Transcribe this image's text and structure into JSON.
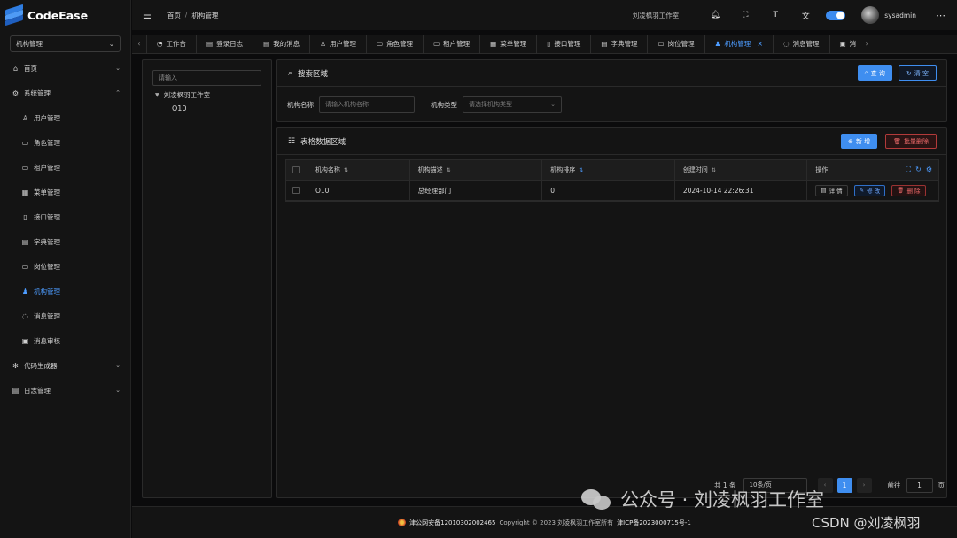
{
  "app": {
    "name": "CodeEase"
  },
  "sidebar": {
    "org_select": "机构管理",
    "items": [
      {
        "label": "首页",
        "icon": "home-icon",
        "expandable": true
      },
      {
        "label": "系统管理",
        "icon": "gear-icon",
        "expandable": true,
        "expanded": true
      },
      {
        "label": "用户管理",
        "icon": "user-icon"
      },
      {
        "label": "角色管理",
        "icon": "role-icon"
      },
      {
        "label": "租户管理",
        "icon": "tenant-icon"
      },
      {
        "label": "菜单管理",
        "icon": "grid-icon"
      },
      {
        "label": "接口管理",
        "icon": "api-icon"
      },
      {
        "label": "字典管理",
        "icon": "dictionary-icon"
      },
      {
        "label": "岗位管理",
        "icon": "position-icon"
      },
      {
        "label": "机构管理",
        "icon": "user-icon",
        "active": true
      },
      {
        "label": "消息管理",
        "icon": "message-icon"
      },
      {
        "label": "消息审核",
        "icon": "audit-icon"
      },
      {
        "label": "代码生成器",
        "icon": "gear-icon",
        "expandable": true
      },
      {
        "label": "日志管理",
        "icon": "log-icon",
        "expandable": true
      }
    ]
  },
  "header": {
    "breadcrumb": [
      "首页",
      "机构管理"
    ],
    "studio": "刘凌枫羽工作室",
    "username": "sysadmin"
  },
  "tabs": [
    {
      "label": "工作台",
      "icon": "dashboard-icon"
    },
    {
      "label": "登录日志",
      "icon": "document-icon"
    },
    {
      "label": "我的消息",
      "icon": "document-icon"
    },
    {
      "label": "用户管理",
      "icon": "user-icon"
    },
    {
      "label": "角色管理",
      "icon": "role-icon"
    },
    {
      "label": "租户管理",
      "icon": "tenant-icon"
    },
    {
      "label": "菜单管理",
      "icon": "grid-icon"
    },
    {
      "label": "接口管理",
      "icon": "api-icon"
    },
    {
      "label": "字典管理",
      "icon": "dictionary-icon"
    },
    {
      "label": "岗位管理",
      "icon": "position-icon"
    },
    {
      "label": "机构管理",
      "icon": "user-icon",
      "active": true
    },
    {
      "label": "消息管理",
      "icon": "message-icon"
    },
    {
      "label": "消",
      "icon": "audit-icon"
    }
  ],
  "tree": {
    "search_placeholder": "请输入",
    "root": "刘凌枫羽工作室",
    "children": [
      "O10"
    ]
  },
  "search": {
    "title": "搜索区域",
    "query_button": "查 询",
    "clear_button": "清 空",
    "name_label": "机构名称",
    "name_placeholder": "请输入机构名称",
    "type_label": "机构类型",
    "type_placeholder": "请选择机构类型"
  },
  "table": {
    "title": "表格数据区域",
    "add_button": "新 增",
    "batch_delete_button": "批量删除",
    "columns": [
      "机构名称",
      "机构描述",
      "机构排序",
      "创建时间",
      "操作"
    ],
    "rows": [
      {
        "name": "O10",
        "desc": "总经理部门",
        "sort": "0",
        "created": "2024-10-14 22:26:31"
      }
    ],
    "actions": {
      "detail": "详 情",
      "edit": "修 改",
      "delete": "删 除"
    }
  },
  "pagination": {
    "total": "共 1 条",
    "page_size": "10条/页",
    "current_page": "1",
    "goto_label": "前往",
    "goto_value": "1",
    "page_unit": "页"
  },
  "footer": {
    "police_record": "津公网安备12010302002465",
    "copyright": "Copyright © 2023 刘凌枫羽工作室所有",
    "icp": "津ICP备2023000715号-1"
  },
  "watermark": {
    "wechat": "公众号 · 刘凌枫羽工作室",
    "csdn": "CSDN @刘凌枫羽"
  },
  "colors": {
    "accent": "#3f8ef0",
    "danger": "#e05353",
    "background": "#0b0b0c",
    "panel": "#141414"
  }
}
